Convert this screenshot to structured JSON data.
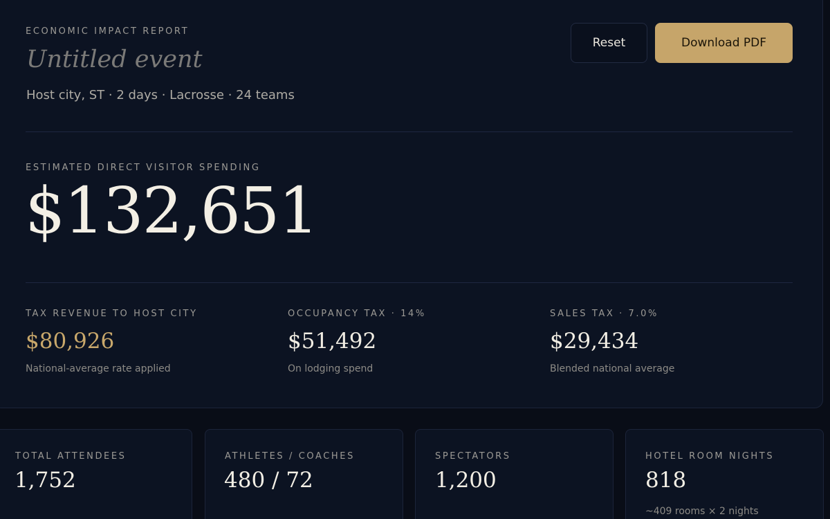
{
  "header": {
    "eyebrow": "ECONOMIC IMPACT REPORT",
    "event_title": "Untitled event",
    "event_meta": "Host city, ST · 2 days · Lacrosse · 24 teams",
    "reset_label": "Reset",
    "download_label": "Download PDF"
  },
  "spending": {
    "label": "ESTIMATED DIRECT VISITOR SPENDING",
    "value": "$132,651"
  },
  "taxes": [
    {
      "label": "TAX REVENUE TO HOST CITY",
      "value": "$80,926",
      "note": "National-average rate applied"
    },
    {
      "label": "OCCUPANCY TAX · 14%",
      "value": "$51,492",
      "note": "On lodging spend"
    },
    {
      "label": "SALES TAX · 7.0%",
      "value": "$29,434",
      "note": "Blended national average"
    }
  ],
  "stats": [
    {
      "label": "TOTAL ATTENDEES",
      "value": "1,752",
      "note": ""
    },
    {
      "label": "ATHLETES / COACHES",
      "value": "480 / 72",
      "note": ""
    },
    {
      "label": "SPECTATORS",
      "value": "1,200",
      "note": ""
    },
    {
      "label": "HOTEL ROOM NIGHTS",
      "value": "818",
      "note": "~409 rooms × 2 nights"
    }
  ],
  "colors": {
    "background": "#090d17",
    "card": "#0c1322",
    "accent_gold": "#c6a56a",
    "text_primary": "#f3efe5",
    "text_muted": "#9c9a95"
  }
}
